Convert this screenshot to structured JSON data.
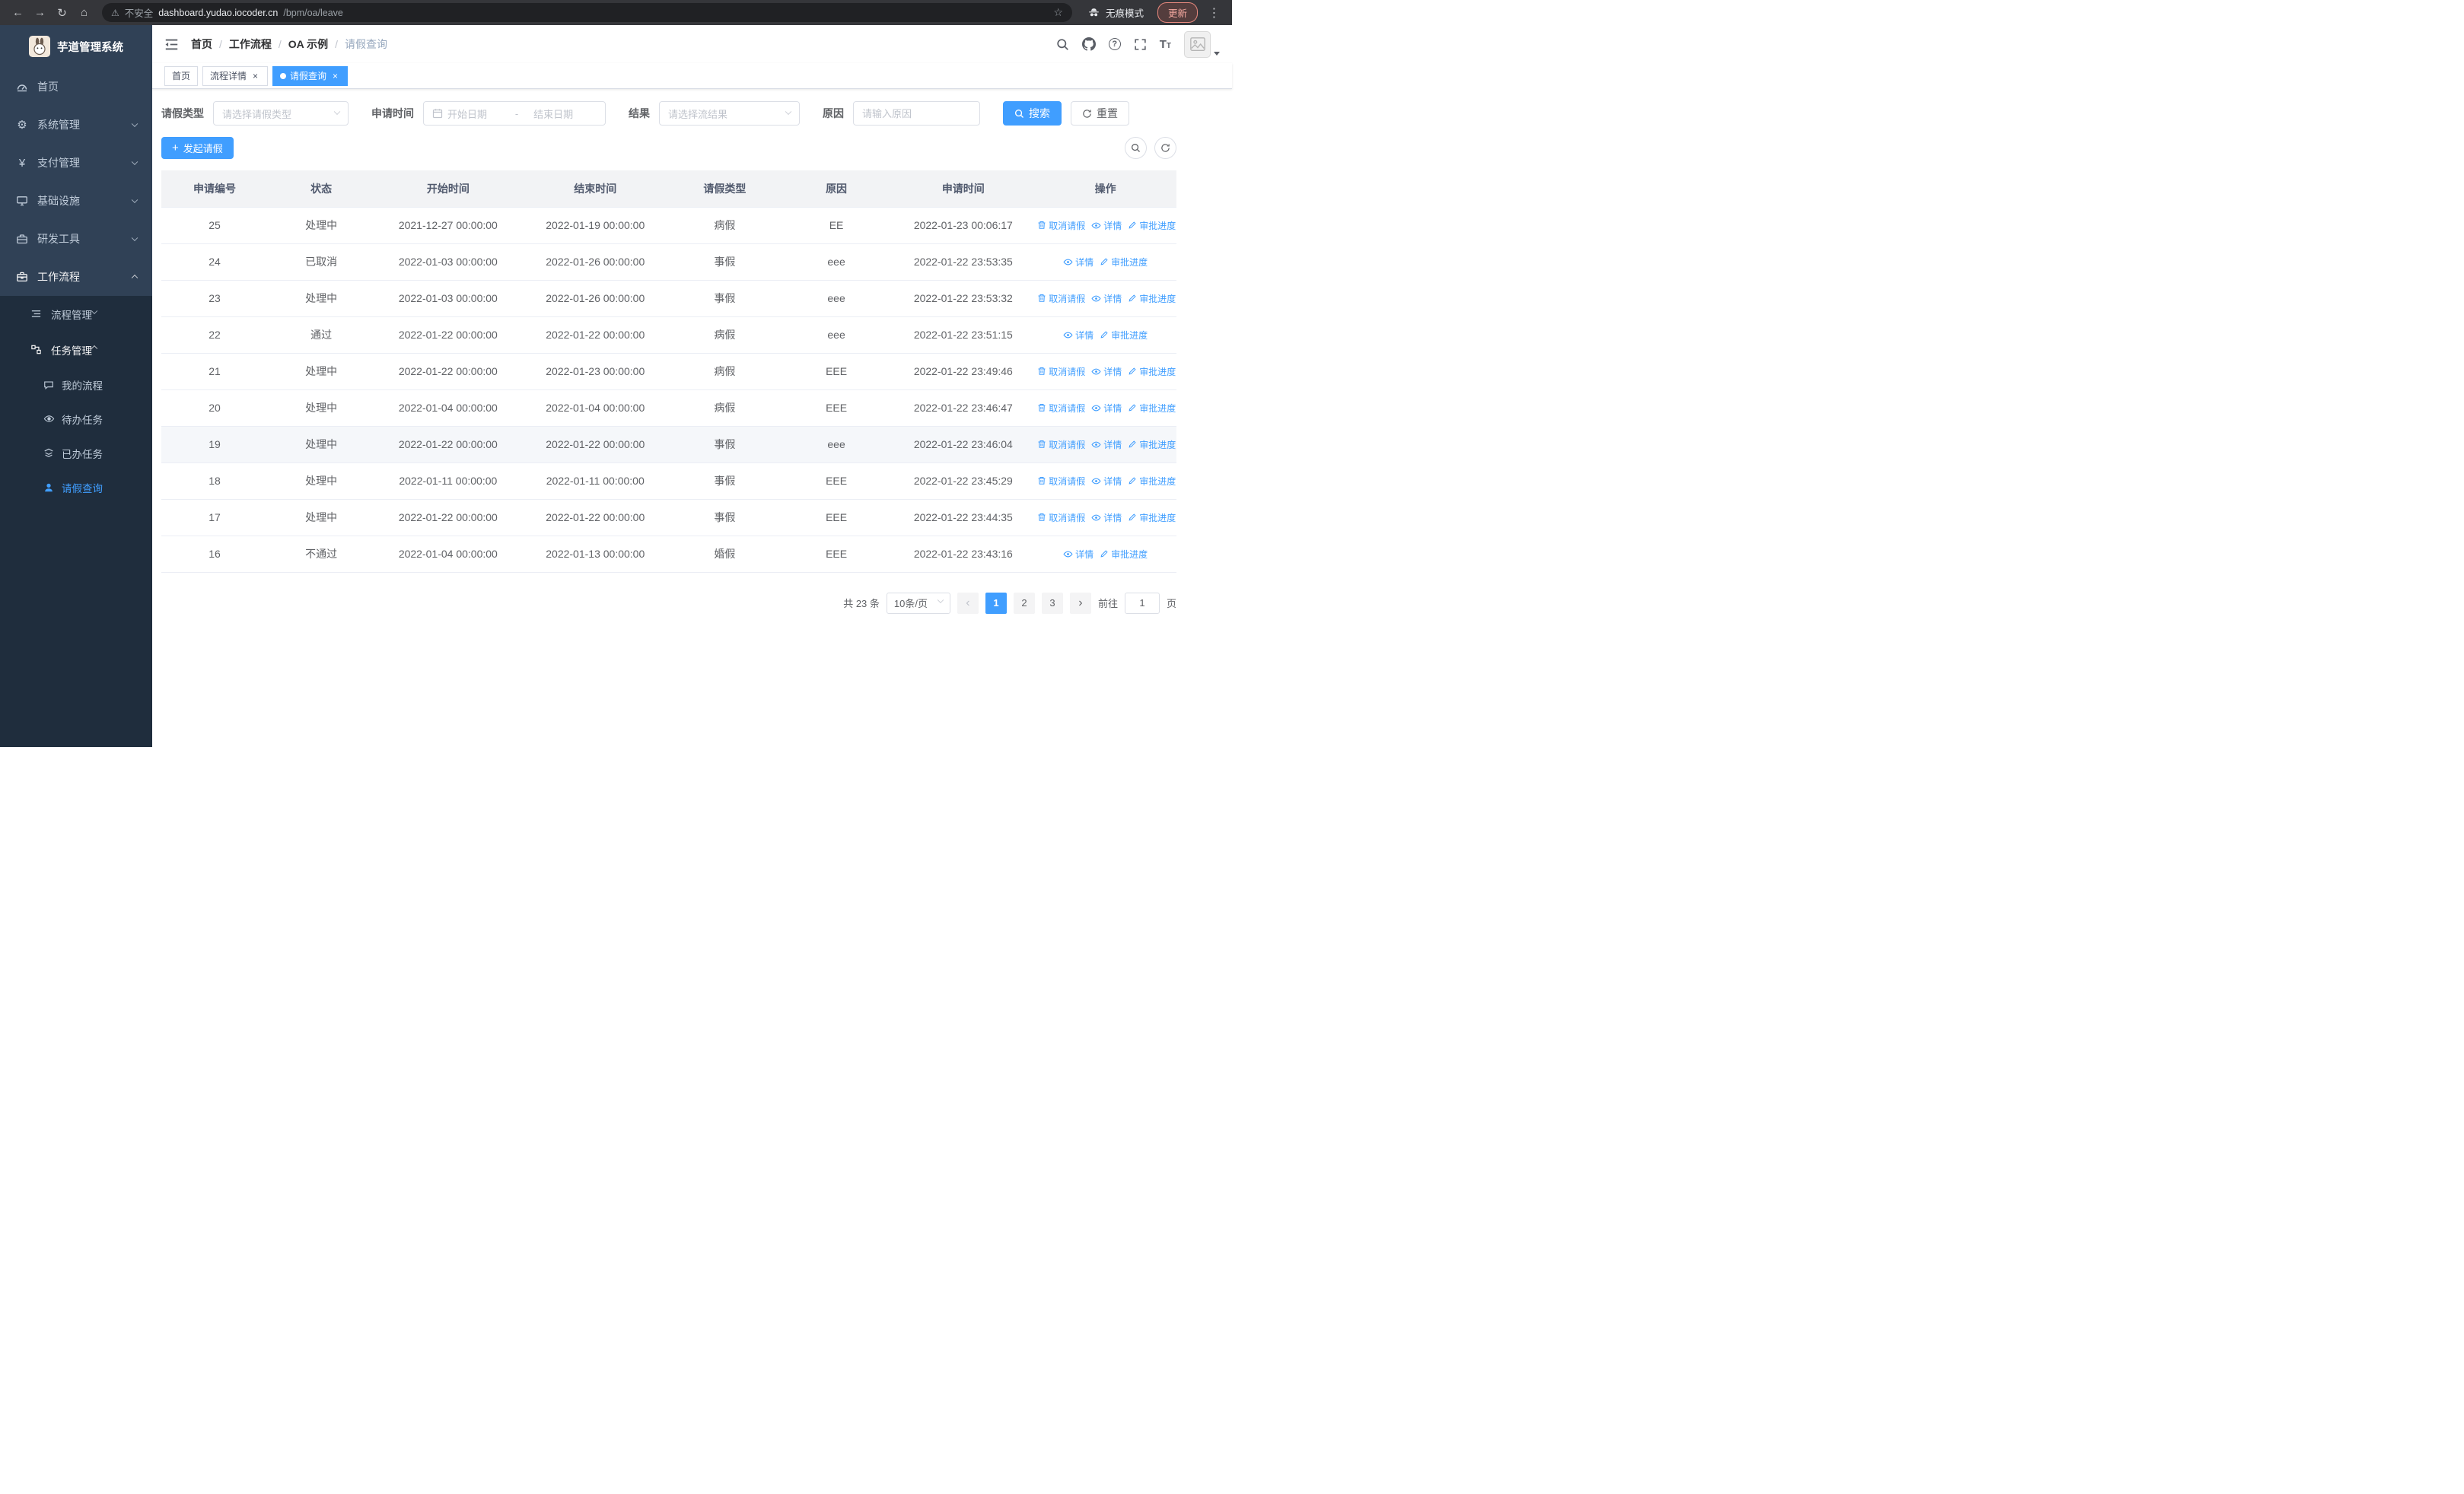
{
  "browser": {
    "security_label": "不安全",
    "url_host": "dashboard.yudao.iocoder.cn",
    "url_path": "/bpm/oa/leave",
    "incognito_label": "无痕模式",
    "update_label": "更新"
  },
  "icons": {
    "back": "←",
    "forward": "→",
    "reload": "↻",
    "home": "⌂",
    "warning": "⚠",
    "star": "☆",
    "menu_dots": "⋮",
    "gear": "⚙",
    "yen": "¥",
    "plus": "+",
    "question": "?",
    "font_big": "T",
    "font_small": "T",
    "prev": "‹",
    "next": "›"
  },
  "sidebar": {
    "app_title": "芋道管理系统",
    "items": [
      {
        "label": "首页"
      },
      {
        "label": "系统管理"
      },
      {
        "label": "支付管理"
      },
      {
        "label": "基础设施"
      },
      {
        "label": "研发工具"
      },
      {
        "label": "工作流程"
      }
    ],
    "sub_items": [
      {
        "label": "流程管理"
      },
      {
        "label": "任务管理"
      }
    ],
    "task_items": [
      {
        "label": "我的流程"
      },
      {
        "label": "待办任务"
      },
      {
        "label": "已办任务"
      },
      {
        "label": "请假查询"
      }
    ]
  },
  "header": {
    "breadcrumb": [
      "首页",
      "工作流程",
      "OA 示例",
      "请假查询"
    ]
  },
  "tabs": [
    {
      "label": "首页"
    },
    {
      "label": "流程详情"
    },
    {
      "label": "请假查询"
    }
  ],
  "filters": {
    "leave_type_label": "请假类型",
    "leave_type_placeholder": "请选择请假类型",
    "apply_time_label": "申请时间",
    "date_start_placeholder": "开始日期",
    "date_separator": "-",
    "date_end_placeholder": "结束日期",
    "result_label": "结果",
    "result_placeholder": "请选择流结果",
    "reason_label": "原因",
    "reason_placeholder": "请输入原因",
    "search_label": "搜索",
    "reset_label": "重置"
  },
  "toolbar": {
    "create_label": "发起请假"
  },
  "table": {
    "columns": [
      "申请编号",
      "状态",
      "开始时间",
      "结束时间",
      "请假类型",
      "原因",
      "申请时间",
      "操作"
    ],
    "action_labels": {
      "cancel": "取消请假",
      "detail": "详情",
      "progress": "审批进度"
    },
    "rows": [
      {
        "id": "25",
        "status": "处理中",
        "start": "2021-12-27 00:00:00",
        "end": "2022-01-19 00:00:00",
        "type": "病假",
        "reason": "EE",
        "applied": "2022-01-23 00:06:17",
        "cancellable": true,
        "highlighted": false
      },
      {
        "id": "24",
        "status": "已取消",
        "start": "2022-01-03 00:00:00",
        "end": "2022-01-26 00:00:00",
        "type": "事假",
        "reason": "eee",
        "applied": "2022-01-22 23:53:35",
        "cancellable": false,
        "highlighted": false
      },
      {
        "id": "23",
        "status": "处理中",
        "start": "2022-01-03 00:00:00",
        "end": "2022-01-26 00:00:00",
        "type": "事假",
        "reason": "eee",
        "applied": "2022-01-22 23:53:32",
        "cancellable": true,
        "highlighted": false
      },
      {
        "id": "22",
        "status": "通过",
        "start": "2022-01-22 00:00:00",
        "end": "2022-01-22 00:00:00",
        "type": "病假",
        "reason": "eee",
        "applied": "2022-01-22 23:51:15",
        "cancellable": false,
        "highlighted": false
      },
      {
        "id": "21",
        "status": "处理中",
        "start": "2022-01-22 00:00:00",
        "end": "2022-01-23 00:00:00",
        "type": "病假",
        "reason": "EEE",
        "applied": "2022-01-22 23:49:46",
        "cancellable": true,
        "highlighted": false
      },
      {
        "id": "20",
        "status": "处理中",
        "start": "2022-01-04 00:00:00",
        "end": "2022-01-04 00:00:00",
        "type": "病假",
        "reason": "EEE",
        "applied": "2022-01-22 23:46:47",
        "cancellable": true,
        "highlighted": false
      },
      {
        "id": "19",
        "status": "处理中",
        "start": "2022-01-22 00:00:00",
        "end": "2022-01-22 00:00:00",
        "type": "事假",
        "reason": "eee",
        "applied": "2022-01-22 23:46:04",
        "cancellable": true,
        "highlighted": true
      },
      {
        "id": "18",
        "status": "处理中",
        "start": "2022-01-11 00:00:00",
        "end": "2022-01-11 00:00:00",
        "type": "事假",
        "reason": "EEE",
        "applied": "2022-01-22 23:45:29",
        "cancellable": true,
        "highlighted": false
      },
      {
        "id": "17",
        "status": "处理中",
        "start": "2022-01-22 00:00:00",
        "end": "2022-01-22 00:00:00",
        "type": "事假",
        "reason": "EEE",
        "applied": "2022-01-22 23:44:35",
        "cancellable": true,
        "highlighted": false
      },
      {
        "id": "16",
        "status": "不通过",
        "start": "2022-01-04 00:00:00",
        "end": "2022-01-13 00:00:00",
        "type": "婚假",
        "reason": "EEE",
        "applied": "2022-01-22 23:43:16",
        "cancellable": false,
        "highlighted": false
      }
    ]
  },
  "pagination": {
    "total_label": "共 23 条",
    "page_size": "10条/页",
    "pages": [
      "1",
      "2",
      "3"
    ],
    "active_page": "1",
    "goto_prefix": "前往",
    "goto_value": "1",
    "goto_suffix": "页"
  },
  "colors": {
    "primary": "#409eff",
    "sidebar_bg": "#304156",
    "submenu_bg": "#1f2d3d",
    "update_pill": "#f6a9a0"
  }
}
